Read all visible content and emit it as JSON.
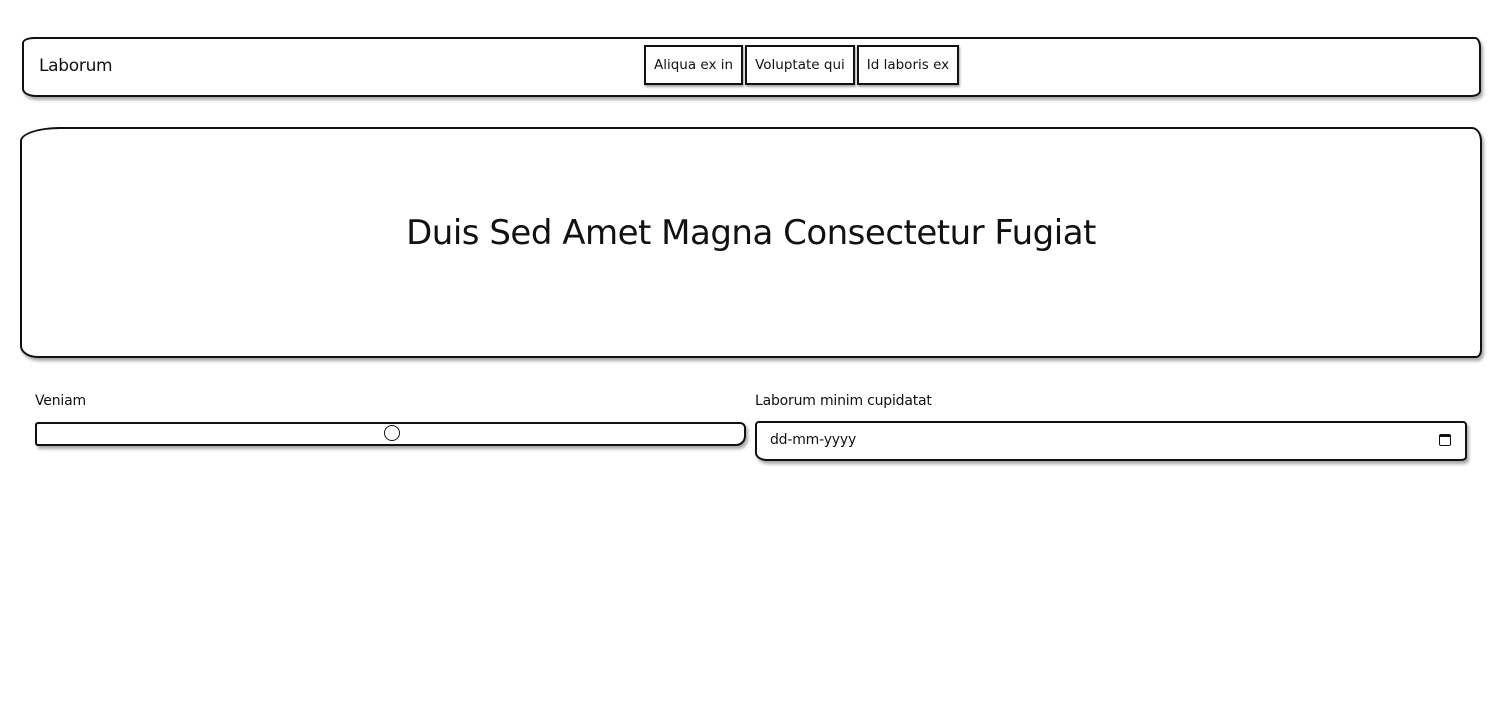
{
  "navbar": {
    "brand": "Laborum",
    "items": [
      {
        "label": "Aliqua ex in"
      },
      {
        "label": "Voluptate qui"
      },
      {
        "label": "Id laboris ex"
      }
    ]
  },
  "hero": {
    "title": "Duis Sed Amet Magna Consectetur Fugiat"
  },
  "form": {
    "slider": {
      "label": "Veniam",
      "value_percent": 50
    },
    "date": {
      "label": "Laborum minim cupidatat",
      "placeholder": "dd-mm-yyyy",
      "icon": "calendar-icon"
    }
  }
}
